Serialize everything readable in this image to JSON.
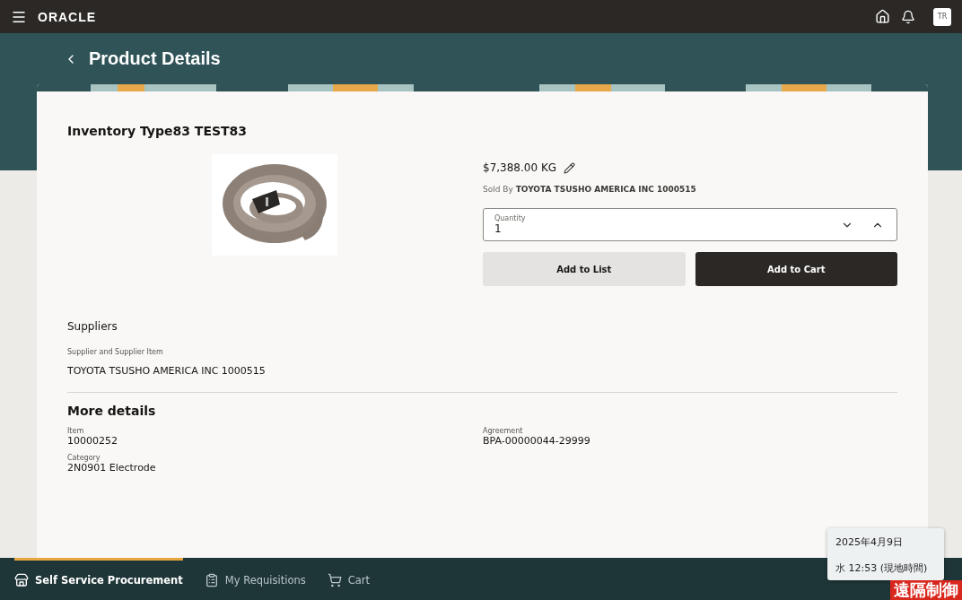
{
  "header": {
    "logo": "ORACLE",
    "avatar": "TR"
  },
  "page": {
    "title": "Product Details"
  },
  "product": {
    "name": "Inventory Type83 TEST83",
    "price": "$7,388.00 KG",
    "sold_by_label": "Sold By",
    "sold_by": "TOYOTA TSUSHO AMERICA INC 1000515",
    "quantity": {
      "label": "Quantity",
      "value": "1"
    },
    "buttons": [
      {
        "label": "Add to List",
        "kind": "secondary"
      },
      {
        "label": "Add to Cart",
        "kind": "primary"
      }
    ]
  },
  "suppliers": {
    "title": "Suppliers",
    "label": "Supplier and Supplier Item",
    "value": "TOYOTA TSUSHO AMERICA INC 1000515"
  },
  "more_details": {
    "title": "More details",
    "fields": [
      {
        "label": "Item",
        "value": "10000252"
      },
      {
        "label": "Agreement",
        "value": "BPA-00000044-29999"
      },
      {
        "label": "Category",
        "value": "2N0901 Electrode"
      }
    ]
  },
  "bottom_nav": [
    {
      "label": "Self Service Procurement",
      "selected": true
    },
    {
      "label": "My Requisitions",
      "selected": false
    },
    {
      "label": "Cart",
      "selected": false
    }
  ],
  "clock_tooltip": {
    "date": "2025年4月9日",
    "time": "水 12:53 (現地時間)"
  },
  "remote_badge": "遠隔制御"
}
